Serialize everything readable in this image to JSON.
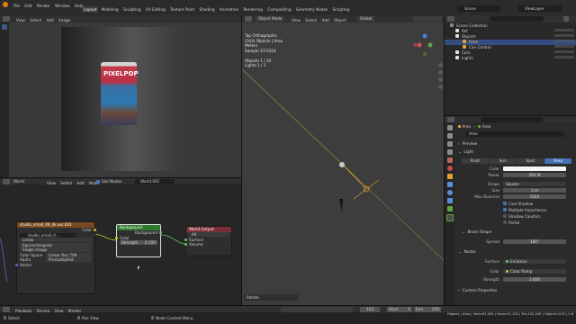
{
  "topbar": {
    "menus": [
      "File",
      "Edit",
      "Render",
      "Window",
      "Help"
    ],
    "workspaces": [
      "Layout",
      "Modeling",
      "Sculpting",
      "UV Editing",
      "Texture Paint",
      "Shading",
      "Animation",
      "Rendering",
      "Compositing",
      "Geometry Nodes",
      "Scripting"
    ],
    "active_workspace": "Layout",
    "scene": "Scene",
    "view_layer": "ViewLayer"
  },
  "image_editor": {
    "menus": [
      "View",
      "Select",
      "Add",
      "Image"
    ]
  },
  "render_preview": {
    "can_text": "PIXELPOP"
  },
  "node_editor": {
    "menus": [
      "View",
      "Select",
      "Add",
      "Node"
    ],
    "world": "World",
    "use_nodes": "Use Nodes",
    "world_slot": "World.001",
    "env_node": {
      "title": "studio_small_09_4k.exr.001",
      "image": "studio_small_0...",
      "color_out": "Color",
      "interp": "Linear",
      "proj": "Equirectangular",
      "ext": "Single Image",
      "cs_label": "Color Space",
      "cs_value": "Linear Rec.709",
      "alpha_label": "Alpha",
      "alpha_value": "Premultiplied",
      "vector": "Vector"
    },
    "bg_node": {
      "title": "Background",
      "out": "Background",
      "color": "Color",
      "strength_label": "Strength",
      "strength": "0.100"
    },
    "out_node": {
      "title": "World Output",
      "target": "All",
      "surface": "Surface",
      "volume": "Volume"
    }
  },
  "viewport": {
    "menus": [
      "View",
      "Select",
      "Add",
      "Object"
    ],
    "mode": "Object Mode",
    "global": "Global",
    "info": [
      "Top Orthographic",
      "(143) Objects | Area",
      "Meters",
      "Sample 37/1024",
      "",
      "Objects   1 / 10",
      "Lights   1 / 1"
    ],
    "rotate_panel": "Rotate"
  },
  "outliner": {
    "title": "Scene Collection",
    "items": [
      {
        "label": "Ref",
        "indent": 1
      },
      {
        "label": "Objects",
        "indent": 1
      },
      {
        "label": "Area",
        "indent": 2,
        "selected": true
      },
      {
        "label": "Can Control",
        "indent": 2
      },
      {
        "label": "Cam",
        "indent": 1
      },
      {
        "label": "Lights",
        "indent": 1
      }
    ]
  },
  "properties": {
    "breadcrumb_obj": "Area",
    "breadcrumb_data": "Area",
    "name": "Area",
    "preview": "Preview",
    "light": "Light",
    "light_types": [
      "Point",
      "Sun",
      "Spot",
      "Area"
    ],
    "active_type": "Area",
    "color_label": "Color",
    "power_label": "Power",
    "power": "350 W",
    "shape_label": "Shape",
    "shape": "Square",
    "size_label": "Size",
    "size": "1 m",
    "bounces_label": "Max Bounces",
    "bounces": "1024",
    "checks": [
      "Cast Shadow",
      "Multiple Importance",
      "Shadow Caustics",
      "Portal"
    ],
    "checked": [
      true,
      true,
      false,
      false
    ],
    "beam_shape": "Beam Shape",
    "spread_label": "Spread",
    "spread": "180°",
    "nodes": "Nodes",
    "surface_label": "Surface",
    "surface": "Emission",
    "ncolor_label": "Color",
    "ncolor": "Color Ramp",
    "strength_label": "Strength",
    "strength": "1.000",
    "custom": "Custom Properties"
  },
  "timeline": {
    "menus": [
      "Playback",
      "Keying",
      "View",
      "Marker"
    ],
    "frame": "143",
    "start_label": "Start",
    "start": "1",
    "end_label": "End",
    "end": "250"
  },
  "statusbar": {
    "left": "Select",
    "mid": "Pan View",
    "right": "Node Context Menu",
    "stats": "Objects | Area | Verts:61,263 | Faces:51,120 | Tris:102,240 | Objects:1/10 | 3.6"
  }
}
